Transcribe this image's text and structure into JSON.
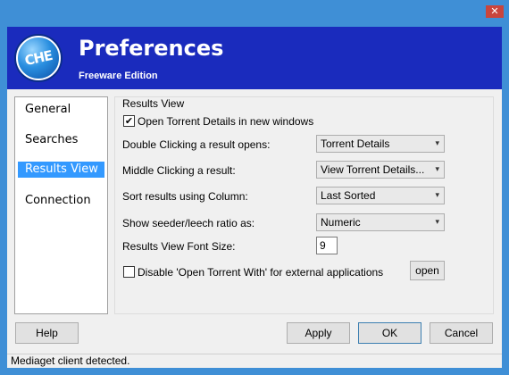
{
  "window": {
    "close_glyph": "✕"
  },
  "header": {
    "logo_text": "CHE",
    "title": "Preferences",
    "subtitle": "Freeware Edition"
  },
  "sidebar": {
    "items": [
      {
        "label": "General",
        "selected": false
      },
      {
        "label": "Searches",
        "selected": false
      },
      {
        "label": "Results View",
        "selected": true
      },
      {
        "label": "Connection",
        "selected": false
      }
    ]
  },
  "panel": {
    "title": "Results View",
    "open_details_checkbox": {
      "label": "Open Torrent Details in new windows",
      "checked": true,
      "glyph": "✔"
    },
    "double_click": {
      "label": "Double Clicking a result opens:",
      "value": "Torrent Details"
    },
    "middle_click": {
      "label": "Middle Clicking a result:",
      "value": "View Torrent Details..."
    },
    "sort_column": {
      "label": "Sort results using Column:",
      "value": "Last Sorted"
    },
    "seeder_ratio": {
      "label": "Show seeder/leech ratio as:",
      "value": "Numeric"
    },
    "font_size": {
      "label": "Results View Font Size:",
      "value": "9"
    },
    "disable_open_with": {
      "label": "Disable 'Open Torrent With' for external applications",
      "checked": false,
      "button": "open"
    },
    "dropdown_glyph": "▾"
  },
  "buttons": {
    "help": "Help",
    "apply": "Apply",
    "ok": "OK",
    "cancel": "Cancel"
  },
  "status": "Mediaget client detected.",
  "colors": {
    "header_bg": "#1a2bbd",
    "frame": "#3f8fd6",
    "selection": "#3399ff"
  }
}
